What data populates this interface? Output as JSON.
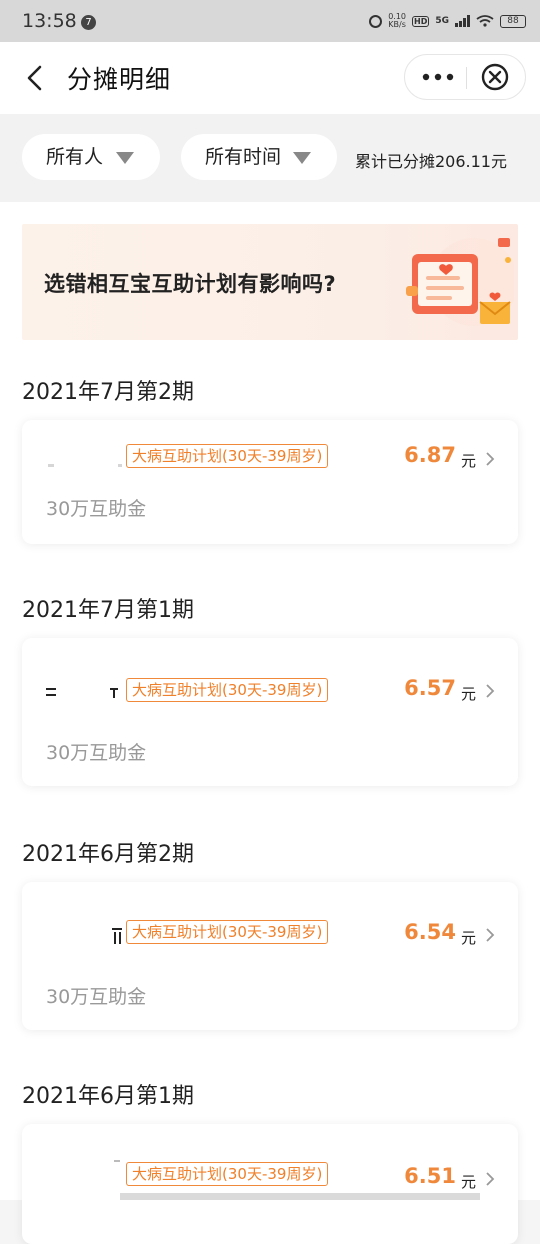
{
  "status_bar": {
    "time": "13:58",
    "notification_count": "7",
    "net_speed_value": "0.10",
    "net_speed_unit": "KB/s",
    "hd_label": "HD",
    "network": "5G",
    "battery": "88"
  },
  "nav": {
    "title": "分摊明细"
  },
  "filters": {
    "owner_label": "所有人",
    "time_label": "所有时间",
    "total_text": "累计已分摊206.11元"
  },
  "banner": {
    "text": "选错相互宝互助计划有影响吗?"
  },
  "periods": [
    {
      "title": "2021年7月第2期",
      "plan_tag": "大病互助计划(30天-39周岁)",
      "amount": "6.87",
      "unit": "元",
      "subtitle": "30万互助金"
    },
    {
      "title": "2021年7月第1期",
      "plan_tag": "大病互助计划(30天-39周岁)",
      "amount": "6.57",
      "unit": "元",
      "subtitle": "30万互助金"
    },
    {
      "title": "2021年6月第2期",
      "plan_tag": "大病互助计划(30天-39周岁)",
      "amount": "6.54",
      "unit": "元",
      "subtitle": "30万互助金"
    },
    {
      "title": "2021年6月第1期",
      "plan_tag": "大病互助计划(30天-39周岁)",
      "amount": "6.51",
      "unit": "元",
      "subtitle": ""
    }
  ],
  "colors": {
    "accent_orange": "#f0883c",
    "tag_border": "#f08a3a",
    "page_bg": "#f5f5f5"
  },
  "icons": [
    "back-icon",
    "more-icon",
    "close-icon",
    "dropdown-triangle-icon",
    "chevron-right-icon",
    "letter-heart-icon"
  ]
}
